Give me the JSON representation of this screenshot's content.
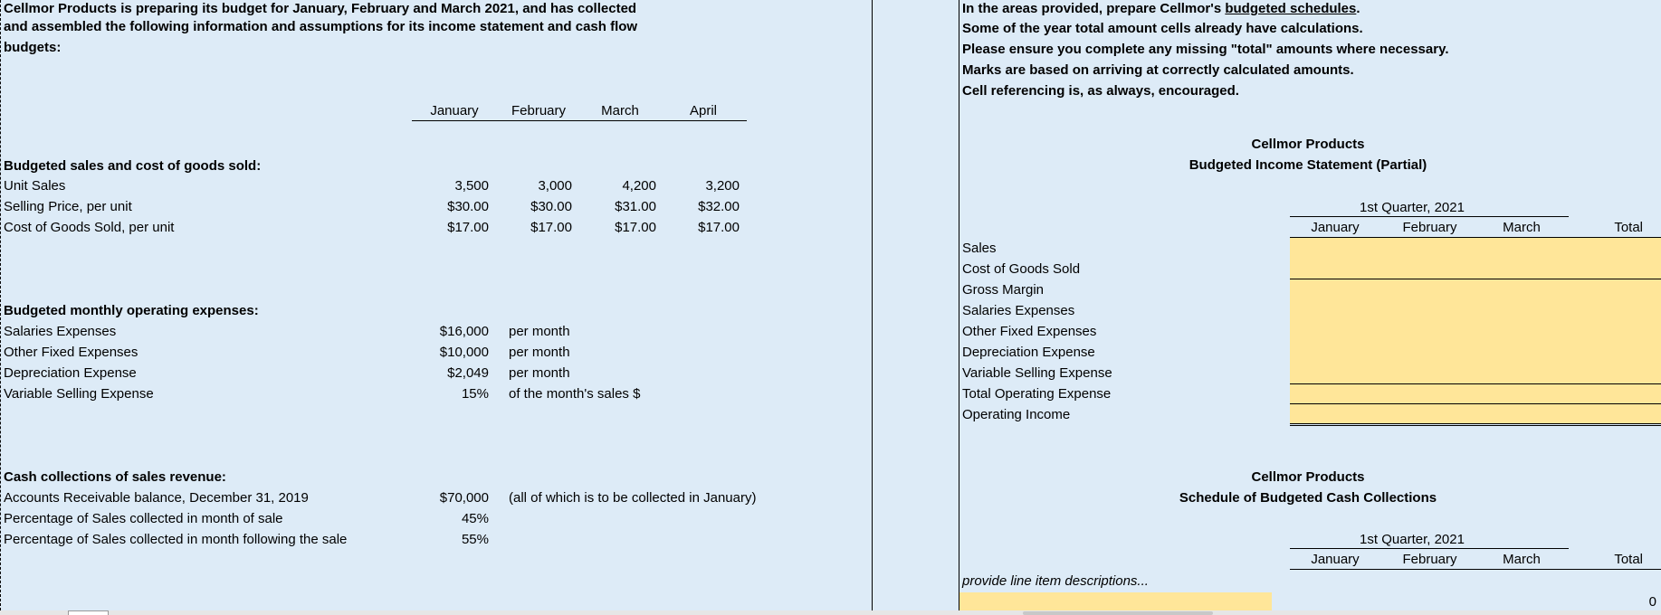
{
  "left": {
    "intro": [
      "Cellmor Products is preparing its budget for January, February and March 2021, and has collected",
      "and assembled the following information and assumptions for its income statement and cash flow",
      "budgets:"
    ],
    "months": [
      "January",
      "February",
      "March",
      "April"
    ],
    "sales_title": "Budgeted sales and cost of goods sold:",
    "sales_rows": [
      {
        "label": "Unit Sales",
        "values": [
          "3,500",
          "3,000",
          "4,200",
          "3,200"
        ]
      },
      {
        "label": "Selling Price, per unit",
        "values": [
          "$30.00",
          "$30.00",
          "$31.00",
          "$32.00"
        ]
      },
      {
        "label": "Cost of Goods Sold, per unit",
        "values": [
          "$17.00",
          "$17.00",
          "$17.00",
          "$17.00"
        ]
      }
    ],
    "opex_title": "Budgeted monthly operating expenses:",
    "opex_rows": [
      {
        "label": "Salaries Expenses",
        "value": "$16,000",
        "note": "per month"
      },
      {
        "label": "Other Fixed Expenses",
        "value": "$10,000",
        "note": "per month"
      },
      {
        "label": "Depreciation Expense",
        "value": "$2,049",
        "note": "per month"
      },
      {
        "label": "Variable Selling Expense",
        "value": "15%",
        "note": "of the month's sales $"
      }
    ],
    "cash_title": "Cash collections of sales revenue:",
    "cash_rows": [
      {
        "label": "Accounts Receivable balance, December 31, 2019",
        "value": "$70,000",
        "note": "(all of which is to be collected in January)"
      },
      {
        "label": "Percentage of Sales collected in month of sale",
        "value": "45%",
        "note": ""
      },
      {
        "label": "Percentage of Sales collected in month following the sale",
        "value": "55%",
        "note": ""
      }
    ]
  },
  "right": {
    "instr_1_pre": "In the areas provided, prepare Cellmor's ",
    "instr_1_link": "budgeted schedules",
    "instr_1_post": ".",
    "instr_2": "Some of the year total amount cells already have calculations.",
    "instr_3": "Please ensure you complete any missing \"total\" amounts where necessary.",
    "instr_4": "Marks are based on arriving at correctly calculated amounts.",
    "instr_5": "Cell referencing is, as always, encouraged.",
    "is_company": "Cellmor Products",
    "is_title": "Budgeted Income Statement (Partial)",
    "quarter": "1st Quarter, 2021",
    "cols": [
      "January",
      "February",
      "March",
      "Total"
    ],
    "is_rows": [
      "Sales",
      "Cost of Goods Sold",
      "Gross Margin",
      "Salaries Expenses",
      "Other Fixed Expenses",
      "Depreciation Expense",
      "Variable Selling Expense",
      "Total Operating Expense",
      "Operating Income"
    ],
    "cc_company": "Cellmor Products",
    "cc_title": "Schedule of Budgeted Cash Collections",
    "cc_quarter": "1st Quarter, 2021",
    "cc_cols": [
      "January",
      "February",
      "March",
      "Total"
    ],
    "cc_hint": "provide line item descriptions...",
    "cc_total_value": "0"
  }
}
